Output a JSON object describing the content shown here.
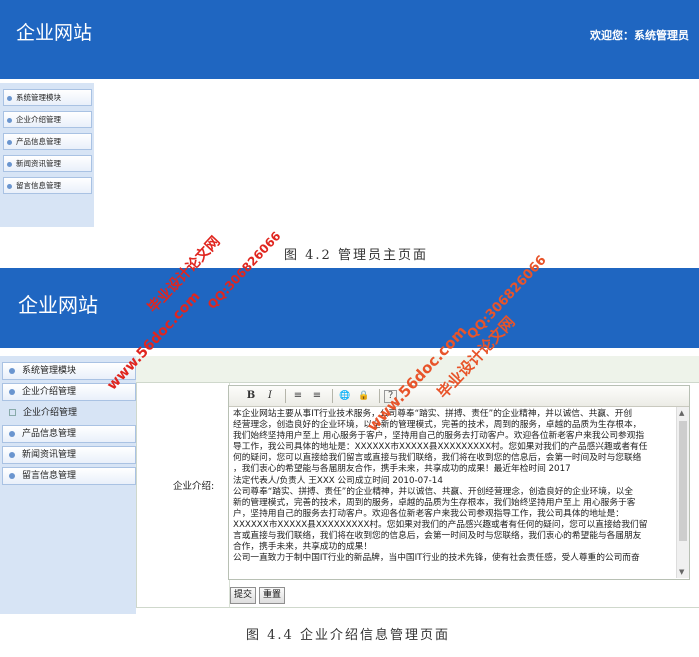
{
  "screen1": {
    "title": "企业网站",
    "welcome": "欢迎您：系统管理员",
    "nav": [
      "系统管理模块",
      "企业介绍管理",
      "产品信息管理",
      "新闻资讯管理",
      "留言信息管理"
    ]
  },
  "caption1": "图 4.2 管理员主页面",
  "screen2": {
    "title": "企业网站",
    "nav": [
      {
        "label": "系统管理模块"
      },
      {
        "label": "企业介绍管理"
      },
      {
        "label": "企业介绍管理"
      },
      {
        "label": "产品信息管理"
      },
      {
        "label": "新闻资讯管理"
      },
      {
        "label": "留言信息管理"
      }
    ],
    "form_label": "企业介绍:",
    "toolbar": [
      "B",
      "I",
      "≡",
      "≡",
      "🌐",
      "🔒",
      "?"
    ],
    "editor_lines": [
      "本企业网站主要从事IT行业技术服务，公司尊奉“踏实、拼搏、责任”的企业精神，并以诚信、共赢、开创",
      "经营理念，创造良好的企业环境，以全新的管理模式，完善的技术，周到的服务，卓越的品质为生存根本，",
      "我们始终坚持用户至上 用心服务于客户，坚持用自己的服务去打动客户。欢迎各位新老客户来我公司参观指",
      "导工作，我公司具体的地址是：XXXXXX市XXXXX县XXXXXXXXX村。您如果对我们的产品感兴趣或者有任",
      "何的疑问，您可以直接给我们留言或直接与我们联络，我们将在收到您的信息后，会第一时间及时与您联络",
      "，我们衷心的希望能与各届朋友合作，携手未来，共享成功的成果！最近年检时间 2017",
      "法定代表人/负责人 王XXX 公司成立时间 2010-07-14",
      "公司尊奉“踏实、拼搏、责任”的企业精神，并以诚信、共赢、开创经营理念，创造良好的企业环境，以全",
      "新的管理模式，完善的技术，周到的服务，卓越的品质为生存根本，我们始终坚持用户至上 用心服务于客",
      "户，坚持用自己的服务去打动客户。欢迎各位新老客户来我公司参观指导工作，我公司具体的地址是：",
      "XXXXXX市XXXXX县XXXXXXXXX村。您如果对我们的产品感兴趣或者有任何的疑问，您可以直接给我们留",
      "言或直接与我们联络，我们将在收到您的信息后，会第一时间及时与您联络，我们衷心的希望能与各届朋友",
      "合作，携手未来，共享成功的成果！",
      "公司一直致力于制中国IT行业的新品牌，当中国IT行业的技术先锋，使有社会责任感，受人尊重的公司而奋"
    ],
    "submit_label": "提交",
    "reset_label": "重置"
  },
  "caption2": "图 4.4 企业介绍信息管理页面",
  "watermarks": {
    "site_cn": "毕业设计论文网",
    "site_url": "www.56doc.com",
    "qq": "QQ:306826066"
  }
}
